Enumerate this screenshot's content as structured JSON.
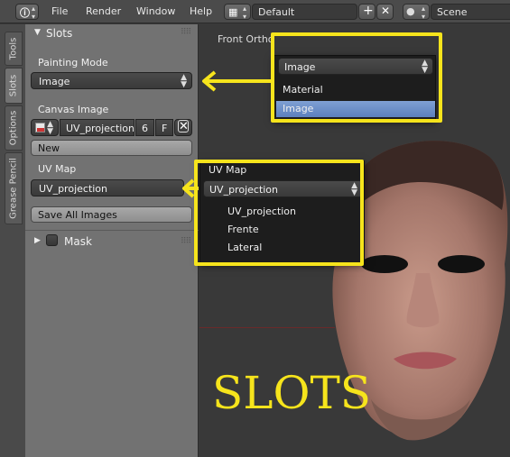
{
  "header": {
    "menus": [
      "File",
      "Render",
      "Window",
      "Help"
    ],
    "screen_name": "Default",
    "scene_name": "Scene"
  },
  "side_tabs": [
    "Tools",
    "Slots",
    "Options",
    "Grease Pencil"
  ],
  "panel": {
    "title": "Slots",
    "painting_mode_label": "Painting Mode",
    "painting_mode_value": "Image",
    "canvas_image_label": "Canvas Image",
    "canvas_image_name": "UV_projection",
    "canvas_image_users": "6",
    "canvas_image_fake": "F",
    "new_button": "New",
    "uv_map_label": "UV Map",
    "uv_map_value": "UV_projection",
    "save_all_button": "Save All Images",
    "mask_label": "Mask"
  },
  "viewport": {
    "view_label": "Front Ortho",
    "mode_popup": {
      "current": "Image",
      "options": [
        "Material",
        "Image"
      ],
      "selected": "Image"
    },
    "uv_popup": {
      "label": "UV Map",
      "current": "UV_projection",
      "options": [
        "UV_projection",
        "Frente",
        "Lateral"
      ]
    },
    "caption": "SLOTS"
  },
  "colors": {
    "highlight_box": "#f6e41c",
    "selected_item": "#5c80bd",
    "panel_bg": "#727272"
  }
}
